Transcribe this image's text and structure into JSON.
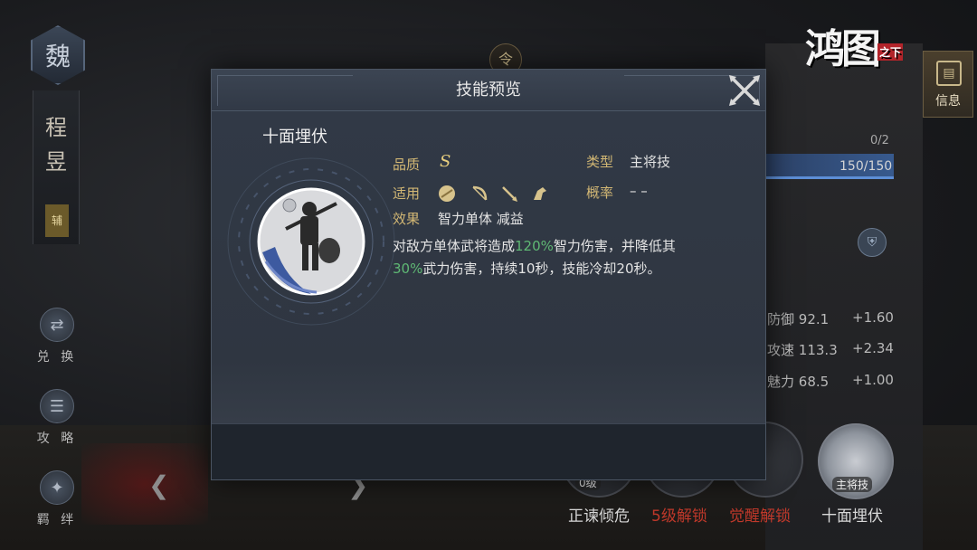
{
  "colors": {
    "label_gold": "#d2b774",
    "highlight_green": "#5fb874",
    "warn_red": "#c0392b",
    "modal_bg": "#2d3440"
  },
  "hero": {
    "faction": "魏",
    "name_chars": [
      "程",
      "昱"
    ],
    "role": "辅"
  },
  "sidebar": {
    "items": [
      {
        "label": "兑 换",
        "icon": "exchange-icon"
      },
      {
        "label": "攻 略",
        "icon": "guide-scroll-icon"
      },
      {
        "label": "羁 绊",
        "icon": "bond-icon"
      }
    ]
  },
  "top": {
    "ling": "令",
    "logo_text": "鸿图",
    "logo_seal": "之下",
    "info_label": "信息"
  },
  "right_panel": {
    "count": "0/2",
    "hp": "150/150",
    "stats": [
      {
        "name": "防御",
        "value": "92.1",
        "plus": "+1.60"
      },
      {
        "name": "攻速",
        "value": "113.3",
        "plus": "+2.34"
      },
      {
        "name": "魅力",
        "value": "68.5",
        "plus": "+1.00"
      }
    ]
  },
  "bottom_skills": {
    "lv_text": "0级",
    "main_tag": "主将技",
    "labels": [
      {
        "text": "正谏倾危",
        "color": "#d8d8d8"
      },
      {
        "text": "5级解锁",
        "color": "#c0392b"
      },
      {
        "text": "觉醒解锁",
        "color": "#c0392b"
      },
      {
        "text": "十面埋伏",
        "color": "#d8d8d8"
      }
    ]
  },
  "modal": {
    "title": "技能预览",
    "skill": {
      "name": "十面埋伏",
      "quality_label": "品质",
      "quality_value": "S",
      "type_label": "类型",
      "type_value": "主将技",
      "applicable_label": "适用",
      "applicable_units": [
        "shield-unit-icon",
        "bow-unit-icon",
        "spear-unit-icon",
        "cavalry-unit-icon"
      ],
      "rate_label": "概率",
      "rate_value": "– –",
      "effect_label": "效果",
      "effect_value": "智力单体 减益",
      "desc_part1": "对敌方单体武将造成",
      "desc_hl1": "120%",
      "desc_part2": "智力伤害，并降低其",
      "desc_hl2": "30%",
      "desc_part3": "武力伤害，持续10秒，技能冷却20秒。"
    }
  }
}
